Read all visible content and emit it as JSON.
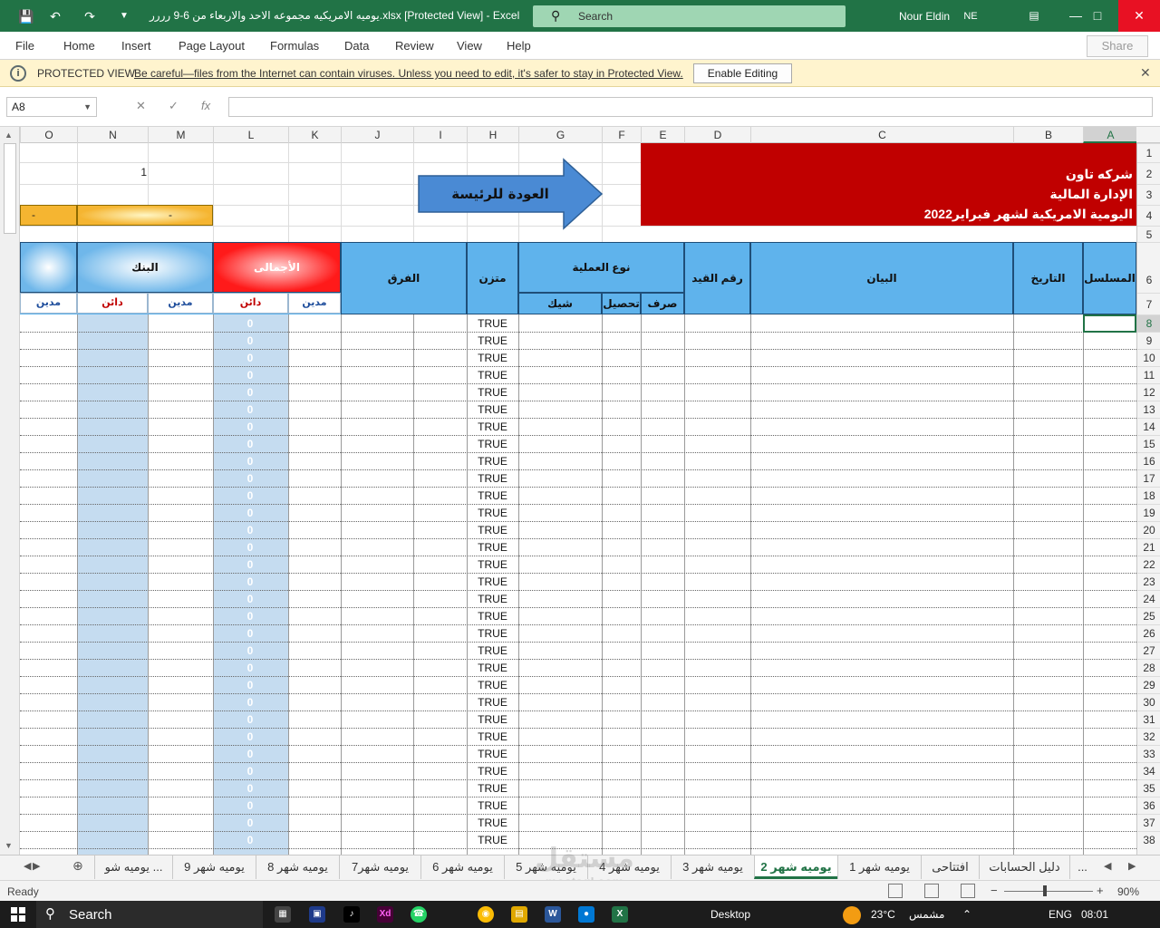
{
  "titlebar": {
    "title": "يوميه الامريكيه مجموعه الاحد والاربعاء من 6-9 رررر.xlsx  [Protected View]  -  Excel",
    "search_placeholder": "Search",
    "user_name": "Nour Eldin",
    "user_initials": "NE",
    "colors": {
      "accent": "#217346",
      "close": "#e81123"
    }
  },
  "menu": {
    "items": [
      "File",
      "Home",
      "Insert",
      "Page Layout",
      "Formulas",
      "Data",
      "Review",
      "View",
      "Help"
    ],
    "share": "Share"
  },
  "protected_view": {
    "title": "PROTECTED VIEW",
    "message": "Be careful—files from the Internet can contain viruses. Unless you need to edit, it's safer to stay in Protected View.",
    "button": "Enable Editing"
  },
  "formula_bar": {
    "name_box": "A8",
    "fx": "fx",
    "value": ""
  },
  "grid": {
    "selected_cell": "A8",
    "columns": [
      "O",
      "N",
      "M",
      "L",
      "K",
      "J",
      "I",
      "H",
      "G",
      "F",
      "E",
      "D",
      "C",
      "B",
      "A"
    ],
    "rows": [
      "1",
      "2",
      "3",
      "4",
      "5",
      "6",
      "7",
      "8",
      "9",
      "10",
      "11",
      "12",
      "13",
      "14",
      "15",
      "16",
      "17",
      "18",
      "19",
      "20",
      "21",
      "22",
      "23",
      "24",
      "25",
      "26",
      "27",
      "28",
      "29",
      "30",
      "31",
      "32",
      "33",
      "34",
      "35",
      "36",
      "37",
      "38"
    ],
    "banner": {
      "line1": "شركه تاون",
      "line2": "الإدارة المالية",
      "line3": "اليومية الامريكية لشهر فبراير2022",
      "color": "#c00000"
    },
    "back_arrow_label": "العودة للرئيسة",
    "n2_value": "1",
    "row4_o": "-",
    "row4_n": "-",
    "headers": {
      "serial": "المسلسل",
      "date": "التاريخ",
      "statement": "البيان",
      "entry_no": "رقم القيد",
      "operation_type": "نوع العملية",
      "spend": "صرف",
      "collect": "تحصيل",
      "check": "شيك",
      "balanced": "متزن",
      "difference": "الفرق",
      "totals": "الأجمالى",
      "bank": "البنك",
      "debit": "مدين",
      "credit": "دائن"
    },
    "balanced_values": [
      "TRUE",
      "TRUE",
      "TRUE",
      "TRUE",
      "TRUE",
      "TRUE",
      "TRUE",
      "TRUE",
      "TRUE",
      "TRUE",
      "TRUE",
      "TRUE",
      "TRUE",
      "TRUE",
      "TRUE",
      "TRUE",
      "TRUE",
      "TRUE",
      "TRUE",
      "TRUE",
      "TRUE",
      "TRUE",
      "TRUE",
      "TRUE",
      "TRUE",
      "TRUE",
      "TRUE",
      "TRUE",
      "TRUE",
      "TRUE",
      "TRUE"
    ],
    "totals_credit_values": [
      "0",
      "0",
      "0",
      "0",
      "0",
      "0",
      "0",
      "0",
      "0",
      "0",
      "0",
      "0",
      "0",
      "0",
      "0",
      "0",
      "0",
      "0",
      "0",
      "0",
      "0",
      "0",
      "0",
      "0",
      "0",
      "0",
      "0",
      "0",
      "0",
      "0",
      "0"
    ]
  },
  "tabs": {
    "active": "يوميه شهر 2",
    "items": [
      "...",
      "دليل الحسابات",
      "افتتاحى",
      "يوميه شهر 1",
      "يوميه شهر 2",
      "يوميه شهر 3",
      "يوميه شهر 4",
      "يوميه شهر 5",
      "يوميه شهر 6",
      "يوميه شهر7",
      "يوميه شهر 8",
      "يوميه شهر 9",
      "يوميه شو ..."
    ]
  },
  "watermark": {
    "ar": "مستقل",
    "en": "mostaql.com"
  },
  "status": {
    "ready": "Ready",
    "zoom": "90%"
  },
  "taskbar": {
    "search": "Search",
    "desktop": "Desktop",
    "temperature": "23°C",
    "weather": "مشمس",
    "lang": "ENG",
    "time": "08:01"
  }
}
